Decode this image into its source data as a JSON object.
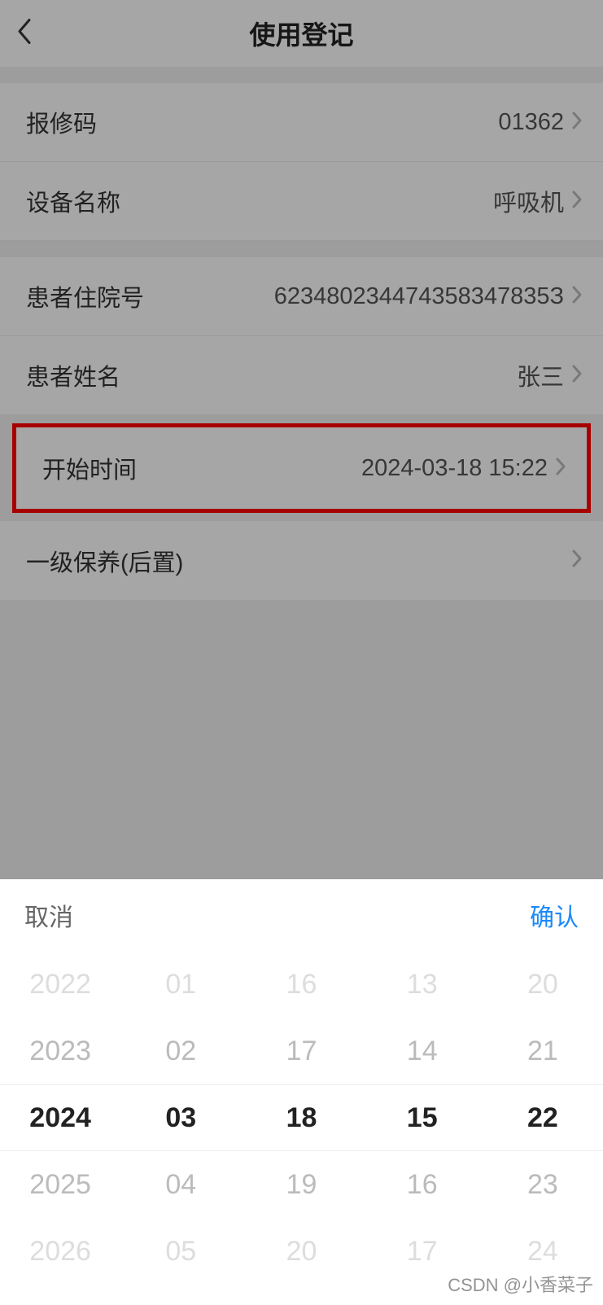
{
  "header": {
    "title": "使用登记"
  },
  "form": {
    "repair_code": {
      "label": "报修码",
      "value": "01362"
    },
    "device_name": {
      "label": "设备名称",
      "value": "呼吸机"
    },
    "patient_id": {
      "label": "患者住院号",
      "value": "623480234474358347835З"
    },
    "patient_name": {
      "label": "患者姓名",
      "value": "张三"
    },
    "start_time": {
      "label": "开始时间",
      "value": "2024-03-18 15:22"
    },
    "maintenance": {
      "label": "一级保养(后置)",
      "value": ""
    }
  },
  "picker": {
    "cancel_label": "取消",
    "confirm_label": "确认",
    "columns": [
      {
        "options": [
          "2022",
          "2023",
          "2024",
          "2025",
          "2026"
        ]
      },
      {
        "options": [
          "01",
          "02",
          "03",
          "04",
          "05"
        ]
      },
      {
        "options": [
          "16",
          "17",
          "18",
          "19",
          "20"
        ]
      },
      {
        "options": [
          "13",
          "14",
          "15",
          "16",
          "17"
        ]
      },
      {
        "options": [
          "20",
          "21",
          "22",
          "23",
          "24"
        ]
      }
    ]
  },
  "watermark": "CSDN @小香菜子"
}
